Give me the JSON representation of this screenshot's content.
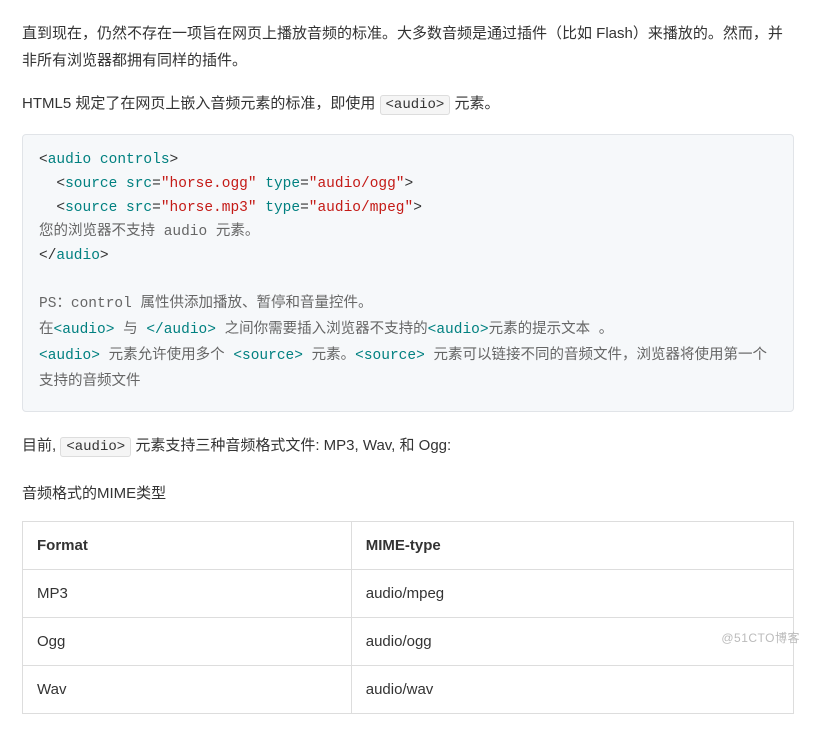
{
  "paragraphs": {
    "p1": "直到现在，仍然不存在一项旨在网页上播放音频的标准。大多数音频是通过插件（比如 Flash）来播放的。然而，并非所有浏览器都拥有同样的插件。",
    "p2_before": "HTML5 规定了在网页上嵌入音频元素的标准，即使用 ",
    "p2_code": "<audio>",
    "p2_after": " 元素。"
  },
  "code_example": {
    "lines": [
      [
        {
          "t": "<",
          "c": "punct"
        },
        {
          "t": "audio",
          "c": "tag"
        },
        {
          "t": " ",
          "c": ""
        },
        {
          "t": "controls",
          "c": "attr-name"
        },
        {
          "t": ">",
          "c": "punct"
        }
      ],
      [
        {
          "t": "  ",
          "c": ""
        },
        {
          "t": "<",
          "c": "punct"
        },
        {
          "t": "source",
          "c": "tag"
        },
        {
          "t": " ",
          "c": ""
        },
        {
          "t": "src",
          "c": "attr-name"
        },
        {
          "t": "=",
          "c": "punct"
        },
        {
          "t": "\"horse.ogg\"",
          "c": "attr-val"
        },
        {
          "t": " ",
          "c": ""
        },
        {
          "t": "type",
          "c": "attr-name"
        },
        {
          "t": "=",
          "c": "punct"
        },
        {
          "t": "\"audio/ogg\"",
          "c": "attr-val"
        },
        {
          "t": ">",
          "c": "punct"
        }
      ],
      [
        {
          "t": "  ",
          "c": ""
        },
        {
          "t": "<",
          "c": "punct"
        },
        {
          "t": "source",
          "c": "tag"
        },
        {
          "t": " ",
          "c": ""
        },
        {
          "t": "src",
          "c": "attr-name"
        },
        {
          "t": "=",
          "c": "punct"
        },
        {
          "t": "\"horse.mp3\"",
          "c": "attr-val"
        },
        {
          "t": " ",
          "c": ""
        },
        {
          "t": "type",
          "c": "attr-name"
        },
        {
          "t": "=",
          "c": "punct"
        },
        {
          "t": "\"audio/mpeg\"",
          "c": "attr-val"
        },
        {
          "t": ">",
          "c": "punct"
        }
      ],
      [
        {
          "t": "您的浏览器不支持 audio 元素。",
          "c": ""
        }
      ],
      [
        {
          "t": "</",
          "c": "punct"
        },
        {
          "t": "audio",
          "c": "tag"
        },
        {
          "t": ">",
          "c": "punct"
        }
      ]
    ],
    "ps": {
      "line1": [
        {
          "t": "PS：",
          "c": ""
        },
        {
          "t": "control",
          "c": "mono"
        },
        {
          "t": " 属性供添加播放、暂停和音量控件。",
          "c": ""
        }
      ],
      "line2": [
        {
          "t": "在",
          "c": ""
        },
        {
          "t": "<audio>",
          "c": "tag mono"
        },
        {
          "t": " 与 ",
          "c": ""
        },
        {
          "t": "</audio>",
          "c": "tag mono"
        },
        {
          "t": " 之间你需要插入浏览器不支持的",
          "c": ""
        },
        {
          "t": "<audio>",
          "c": "tag mono"
        },
        {
          "t": "元素的提示文本 。",
          "c": ""
        }
      ],
      "line3": [
        {
          "t": "<audio>",
          "c": "tag mono"
        },
        {
          "t": " 元素允许使用多个 ",
          "c": ""
        },
        {
          "t": "<source>",
          "c": "tag mono"
        },
        {
          "t": " 元素。",
          "c": ""
        },
        {
          "t": "<source>",
          "c": "tag mono"
        },
        {
          "t": " 元素可以链接不同的音频文件，浏览器将使用第一个支持的音频文件",
          "c": ""
        }
      ]
    }
  },
  "p3": {
    "before": "目前, ",
    "code": "<audio>",
    "after": " 元素支持三种音频格式文件: MP3, Wav, 和 Ogg:"
  },
  "section_heading": "音频格式的MIME类型",
  "table": {
    "headers": [
      "Format",
      "MIME-type"
    ],
    "rows": [
      [
        "MP3",
        "audio/mpeg"
      ],
      [
        "Ogg",
        "audio/ogg"
      ],
      [
        "Wav",
        "audio/wav"
      ]
    ]
  },
  "watermark": "@51CTO博客"
}
